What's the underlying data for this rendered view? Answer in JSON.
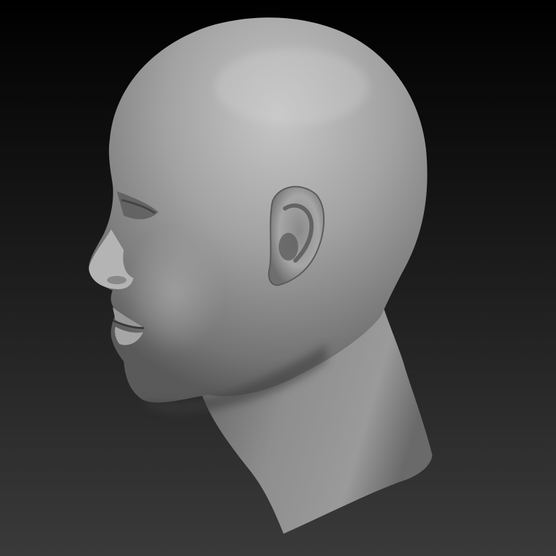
{
  "scene": {
    "subject": "head-sculpt",
    "view": "left-profile",
    "colors": {
      "background_top": "#000000",
      "background_bottom": "#3a3a3a",
      "clay_highlight": "#c4c4c4",
      "clay_mid": "#8c8c8c",
      "clay_shadow": "#3c3c3c"
    }
  }
}
